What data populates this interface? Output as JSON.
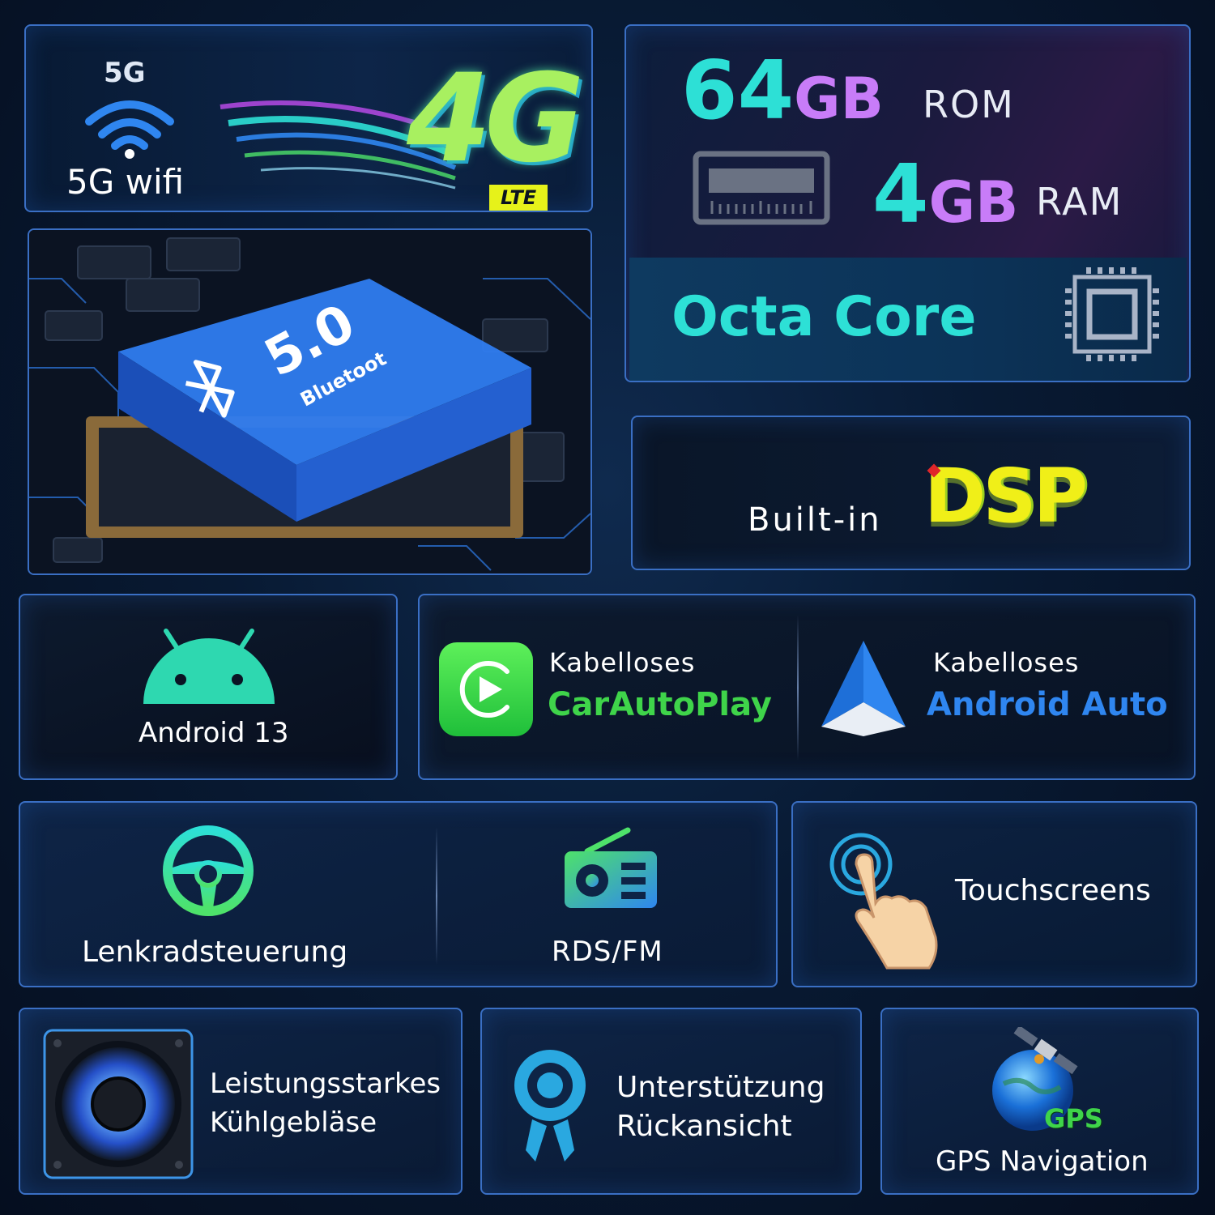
{
  "wifi": {
    "badge": "5G",
    "label": "5G wifi",
    "lte_text": "4G",
    "lte_badge": "LTE",
    "icon": "wifi-icon"
  },
  "memory": {
    "rom_value": "64",
    "rom_unit": "GB",
    "rom_label": "ROM",
    "ram_value": "4",
    "ram_unit": "GB",
    "ram_label": "RAM",
    "cpu_label": "Octa Core",
    "ram_icon": "memory-module-icon",
    "cpu_icon": "processor-chip-icon"
  },
  "bluetooth": {
    "version": "5.0",
    "chip_text": "Bluetoot",
    "icon": "bluetooth-icon"
  },
  "dsp": {
    "prefix": "Built-in",
    "logo_text": "DSP"
  },
  "android": {
    "label": "Android 13",
    "icon": "android-robot-icon"
  },
  "carplay": {
    "left_small": "Kabelloses",
    "left_big": "CarAutoPlay",
    "right_small": "Kabelloses",
    "right_big": "Android Auto",
    "left_icon": "carplay-icon",
    "right_icon": "android-auto-icon"
  },
  "steering": {
    "left_label": "Lenkradsteuerung",
    "right_label": "RDS/FM",
    "left_icon": "steering-wheel-icon",
    "right_icon": "radio-icon"
  },
  "touch": {
    "label": "Touchscreens",
    "icon": "touch-hand-icon"
  },
  "fan": {
    "line1": "Leistungsstarkes",
    "line2": "Kühlgebläse",
    "icon": "cooling-fan-icon"
  },
  "camera": {
    "line1": "Unterstützung",
    "line2": "Rückansicht",
    "icon": "camera-icon"
  },
  "gps": {
    "badge": "GPS",
    "label": "GPS Navigation",
    "icon": "globe-satellite-icon"
  },
  "colors": {
    "accent_cyan": "#2de0d6",
    "accent_green": "#4ee26a",
    "accent_blue": "#2f86f0",
    "border": "#3a6fc4"
  }
}
